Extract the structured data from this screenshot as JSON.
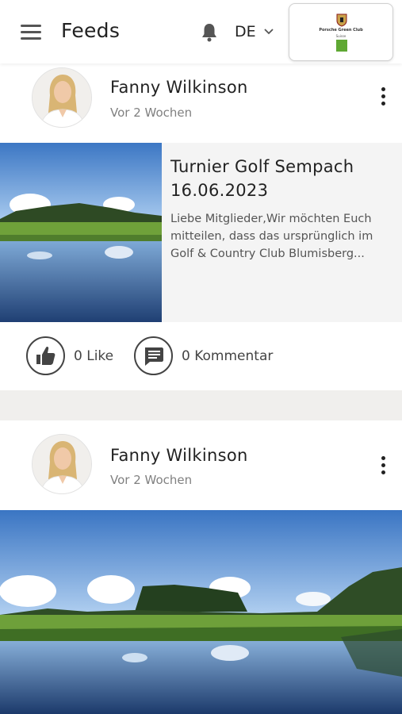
{
  "header": {
    "title": "Feeds",
    "language": "DE",
    "club_logo": {
      "name": "Porsche Green Club",
      "subtitle": "Suisse"
    }
  },
  "posts": [
    {
      "author": "Fanny Wilkinson",
      "time": "Vor 2 Wochen",
      "title": "Turnier Golf Sempach 16.06.2023",
      "excerpt": "Liebe Mitglieder,Wir möchten Euch mitteilen, dass das ursprünglich im Golf & Country Club Blumisberg...",
      "like_label": "0 Like",
      "comment_label": "0 Kommentar"
    },
    {
      "author": "Fanny Wilkinson",
      "time": "Vor 2 Wochen"
    }
  ],
  "colors": {
    "accent_green": "#5fa833",
    "text": "#222222",
    "muted": "#808080"
  }
}
